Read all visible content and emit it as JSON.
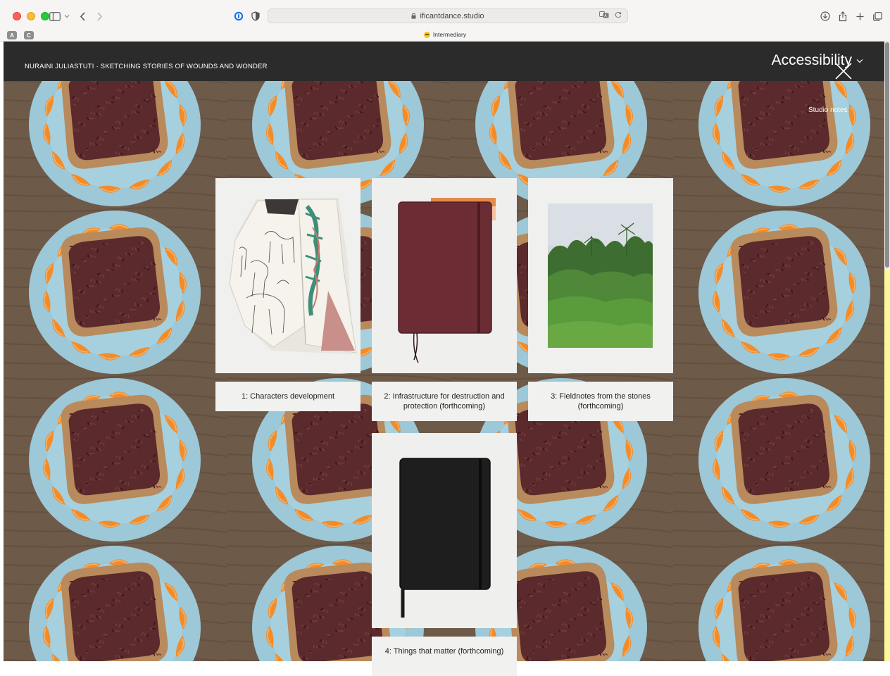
{
  "browser": {
    "url": "ificantdance.studio",
    "tab_title": "Intermediary",
    "tab_pills": [
      "A",
      "C"
    ],
    "colors": {
      "close": "#ff5f57",
      "minimize": "#febc2e",
      "zoom": "#28c840"
    }
  },
  "site": {
    "accessibility_label": "Accessibility",
    "page_title": "Nuraini Juliastuti · Sketching Stories of Wounds and Wonder",
    "studio_notes_label": "Studio notes",
    "colors": {
      "topbar": "#2b2b2b",
      "card": "#f1f1ef",
      "plate": "#9cc8d8",
      "table": "#6a5646"
    }
  },
  "cards": [
    {
      "label": "1: Characters development"
    },
    {
      "label": "2: Infrastructure for destruction and protection (forthcoming)"
    },
    {
      "label": "3: Fieldnotes from the stones (forthcoming)"
    },
    {
      "label": "4: Things that matter (forthcoming)"
    }
  ]
}
